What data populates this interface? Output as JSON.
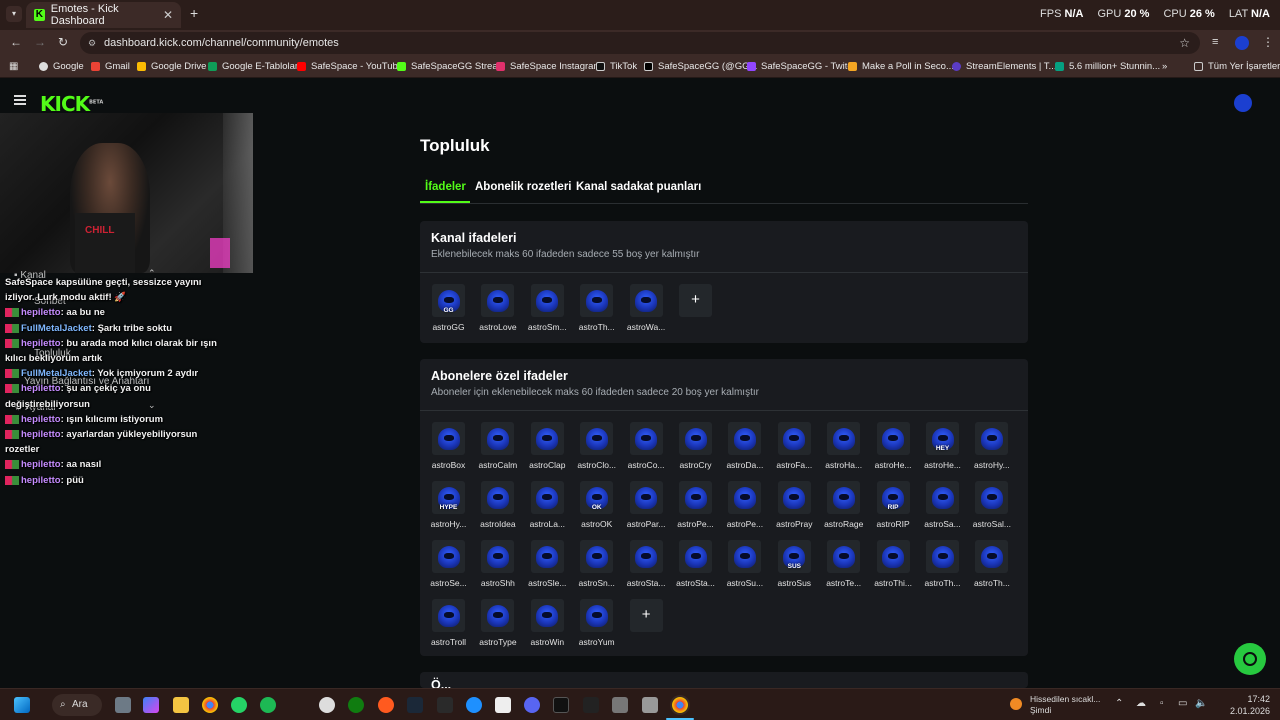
{
  "browser": {
    "tab_title": "Emotes - Kick Dashboard",
    "tab_close": "✕",
    "new_tab": "+",
    "url": "dashboard.kick.com/channel/community/emotes",
    "bookmarks": [
      "Google",
      "Gmail",
      "Google Drive",
      "Google E-Tablolar",
      "SafeSpace - YouTube",
      "SafeSpaceGG Stream",
      "SafeSpace Instagram",
      "TikTok",
      "SafeSpaceGG (@GG...",
      "SafeSpaceGG - Twitch",
      "Make a Poll in Seco...",
      "StreamElements | T...",
      "5.6 million+ Stunnin..."
    ],
    "bookmarks_more": "»",
    "all_bookmarks": "Tüm Yer İşaretleri"
  },
  "overlay_stats": {
    "fps_label": "FPS",
    "fps_value": "N/A",
    "gpu_label": "GPU",
    "gpu_value": "20 %",
    "cpu_label": "CPU",
    "cpu_value": "26 %",
    "lat_label": "LAT",
    "lat_value": "N/A"
  },
  "kick": {
    "logo": "KICK",
    "beta": "BETA"
  },
  "ghost_menu": {
    "kanal": "Kanal",
    "sohbet": "Sohbet",
    "topluluk": "Topluluk",
    "yayin": "Yayın Bağlantısı ve Anahtarı",
    "ayarlar": "Ayarlar"
  },
  "chat": [
    {
      "name": "",
      "text": "SafeSpace kapsülüne geçti, sessizce yayını"
    },
    {
      "name": "",
      "text": "izliyor. Lurk modu aktif! 🚀"
    },
    {
      "name": "hepiletto",
      "color": "p",
      "text": "aa bu ne"
    },
    {
      "name": "FullMetalJacket",
      "color": "b",
      "text": "Şarkı tribe soktu"
    },
    {
      "name": "hepiletto",
      "color": "p",
      "text": "bu arada mod kılıcı olarak bir ışın"
    },
    {
      "name": "",
      "text": "kılıcı bekliyorum artık"
    },
    {
      "name": "FullMetalJacket",
      "color": "b",
      "text": "Yok içmiyorum 2 aydır"
    },
    {
      "name": "hepiletto",
      "color": "p",
      "text": "şu an çekiç ya onu"
    },
    {
      "name": "",
      "text": "değiştirebiliyorsun"
    },
    {
      "name": "hepiletto",
      "color": "p",
      "text": "ışın kılıcımı istiyorum"
    },
    {
      "name": "hepiletto",
      "color": "p",
      "text": "ayarlardan yükleyebiliyorsun"
    },
    {
      "name": "",
      "text": "rozetler"
    },
    {
      "name": "hepiletto",
      "color": "p",
      "text": "aa nasıl"
    },
    {
      "name": "hepiletto",
      "color": "p",
      "text": "püü"
    }
  ],
  "page": {
    "title": "Topluluk",
    "tabs": [
      "İfadeler",
      "Abonelik rozetleri",
      "Kanal sadakat puanları"
    ]
  },
  "channel_emotes": {
    "title": "Kanal ifadeleri",
    "subtitle": "Eklenebilecek maks 60 ifadeden sadece 55 boş yer kalmıştır",
    "items": [
      {
        "label": "astroGG",
        "tag": "GG"
      },
      {
        "label": "astroLove",
        "tag": ""
      },
      {
        "label": "astroSm...",
        "tag": ""
      },
      {
        "label": "astroTh...",
        "tag": ""
      },
      {
        "label": "astroWa...",
        "tag": ""
      }
    ],
    "add": "+"
  },
  "sub_emotes": {
    "title": "Abonelere özel ifadeler",
    "subtitle": "Aboneler için eklenebilecek maks 60 ifadeden sadece 20 boş yer kalmıştır",
    "items": [
      {
        "label": "astroBox",
        "tag": ""
      },
      {
        "label": "astroCalm",
        "tag": ""
      },
      {
        "label": "astroClap",
        "tag": ""
      },
      {
        "label": "astroClo...",
        "tag": ""
      },
      {
        "label": "astroCo...",
        "tag": ""
      },
      {
        "label": "astroCry",
        "tag": ""
      },
      {
        "label": "astroDa...",
        "tag": ""
      },
      {
        "label": "astroFa...",
        "tag": ""
      },
      {
        "label": "astroHa...",
        "tag": ""
      },
      {
        "label": "astroHe...",
        "tag": ""
      },
      {
        "label": "astroHe...",
        "tag": "HEY"
      },
      {
        "label": "astroHy...",
        "tag": ""
      },
      {
        "label": "astroHy...",
        "tag": "HYPE"
      },
      {
        "label": "astroIdea",
        "tag": ""
      },
      {
        "label": "astroLa...",
        "tag": ""
      },
      {
        "label": "astroOK",
        "tag": "OK"
      },
      {
        "label": "astroPar...",
        "tag": ""
      },
      {
        "label": "astroPe...",
        "tag": ""
      },
      {
        "label": "astroPe...",
        "tag": ""
      },
      {
        "label": "astroPray",
        "tag": ""
      },
      {
        "label": "astroRage",
        "tag": ""
      },
      {
        "label": "astroRIP",
        "tag": "RIP"
      },
      {
        "label": "astroSa...",
        "tag": ""
      },
      {
        "label": "astroSal...",
        "tag": ""
      },
      {
        "label": "astroSe...",
        "tag": ""
      },
      {
        "label": "astroShh",
        "tag": ""
      },
      {
        "label": "astroSle...",
        "tag": ""
      },
      {
        "label": "astroSn...",
        "tag": ""
      },
      {
        "label": "astroSta...",
        "tag": ""
      },
      {
        "label": "astroSta...",
        "tag": ""
      },
      {
        "label": "astroSu...",
        "tag": ""
      },
      {
        "label": "astroSus",
        "tag": "SUS"
      },
      {
        "label": "astroTe...",
        "tag": ""
      },
      {
        "label": "astroThi...",
        "tag": ""
      },
      {
        "label": "astroTh...",
        "tag": ""
      },
      {
        "label": "astroTh...",
        "tag": ""
      },
      {
        "label": "astroTroll",
        "tag": ""
      },
      {
        "label": "astroType",
        "tag": ""
      },
      {
        "label": "astroWin",
        "tag": ""
      },
      {
        "label": "astroYum",
        "tag": ""
      }
    ],
    "add": "+"
  },
  "next_card_title": "Ö...",
  "taskbar": {
    "search": "Ara",
    "weather_line1": "Hissedilen sıcakl...",
    "weather_line2": "Şimdi",
    "time": "17:42",
    "date": "2.01.2026"
  },
  "colors": {
    "kick_green": "#53fc18",
    "card_bg": "#191b1f",
    "page_bg": "#0b0e0f",
    "chrome_bg": "#3c2a27"
  }
}
